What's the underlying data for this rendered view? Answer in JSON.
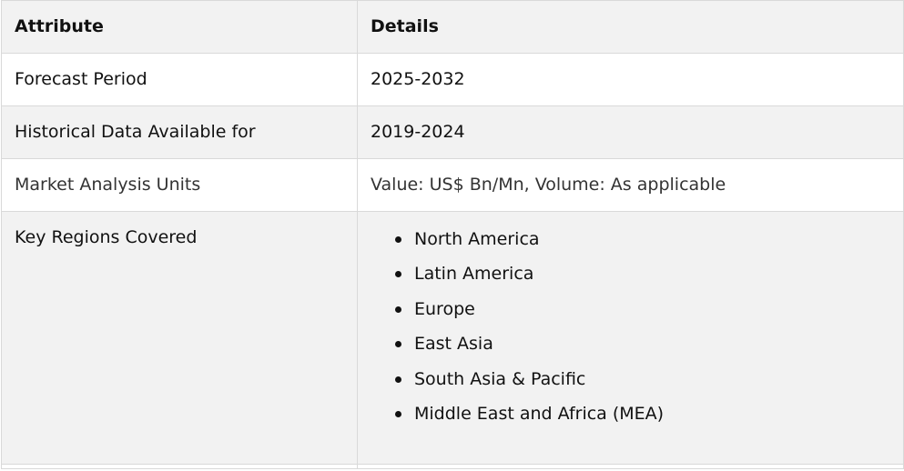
{
  "table": {
    "header": {
      "col1": "Attribute",
      "col2": "Details"
    },
    "rows": [
      {
        "attribute": "Forecast Period",
        "details": "2025-2032"
      },
      {
        "attribute": "Historical Data Available for",
        "details": "2019-2024"
      },
      {
        "attribute": "Market Analysis Units",
        "details": "Value: US$ Bn/Mn, Volume: As applicable"
      }
    ],
    "regions": {
      "attribute": "Key Regions Covered",
      "items": [
        "North America",
        "Latin America",
        "Europe",
        "East Asia",
        "South Asia & Pacific",
        "Middle East and Africa (MEA)"
      ]
    }
  }
}
